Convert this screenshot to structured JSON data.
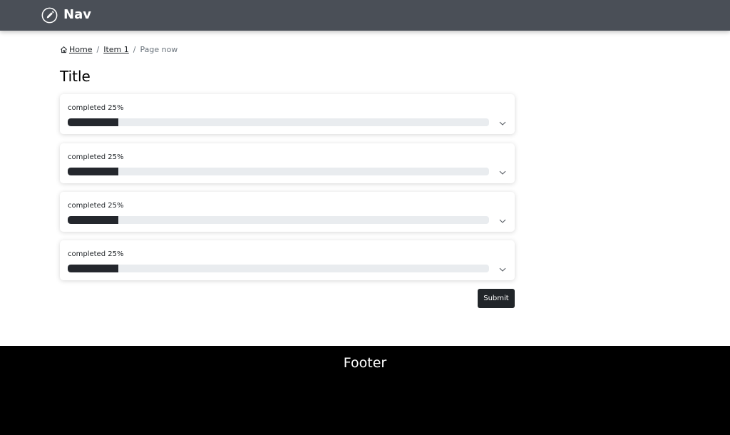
{
  "nav": {
    "brand_label": "Nav",
    "brand_icon": "pencil-icon",
    "background": "#4a4f57"
  },
  "breadcrumb": {
    "home_icon": "home-icon",
    "home_label": "Home",
    "item1_label": "Item 1",
    "separator": "/",
    "current_label": "Page now"
  },
  "page": {
    "title": "Title"
  },
  "progress_items": [
    {
      "label": "completed 25%",
      "progress": 0.12,
      "expand_icon": "chevron-down-icon"
    },
    {
      "label": "completed 25%",
      "progress": 0.12,
      "expand_icon": "chevron-down-icon"
    },
    {
      "label": "completed 25%",
      "progress": 0.12,
      "expand_icon": "chevron-down-icon"
    },
    {
      "label": "completed 25%",
      "progress": 0.12,
      "expand_icon": "chevron-down-icon"
    }
  ],
  "actions": {
    "submit_label": "Submit"
  },
  "footer": {
    "label": "Footer"
  },
  "colors": {
    "accent_dark": "#212529",
    "progress_fill": "#24272d",
    "progress_track": "#e9ecef",
    "footer_bg": "#000000"
  }
}
